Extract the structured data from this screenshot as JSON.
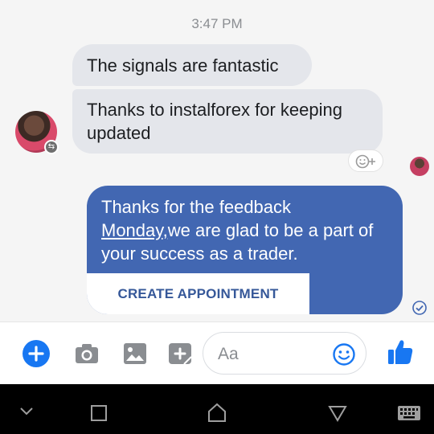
{
  "chat": {
    "timestamp": "3:47 PM",
    "incoming": [
      {
        "text": "The signals are fantastic"
      },
      {
        "text": "Thanks to instalforex for keeping updated"
      }
    ],
    "outgoing": {
      "line1": "Thanks for the feedback",
      "mention": "Monday,",
      "rest": "we are glad to be a part of your success as a trader.",
      "action_button": "CREATE APPOINTMENT"
    }
  },
  "composer": {
    "placeholder": "Aa",
    "icons": [
      "plus-icon",
      "camera-icon",
      "image-icon",
      "sticker-icon",
      "emoji-icon",
      "thumbs-up-icon"
    ]
  },
  "colors": {
    "accent": "#1877f2",
    "outgoing_bubble": "#4267b2",
    "incoming_bubble": "#e4e6eb",
    "button_text": "#365899"
  }
}
